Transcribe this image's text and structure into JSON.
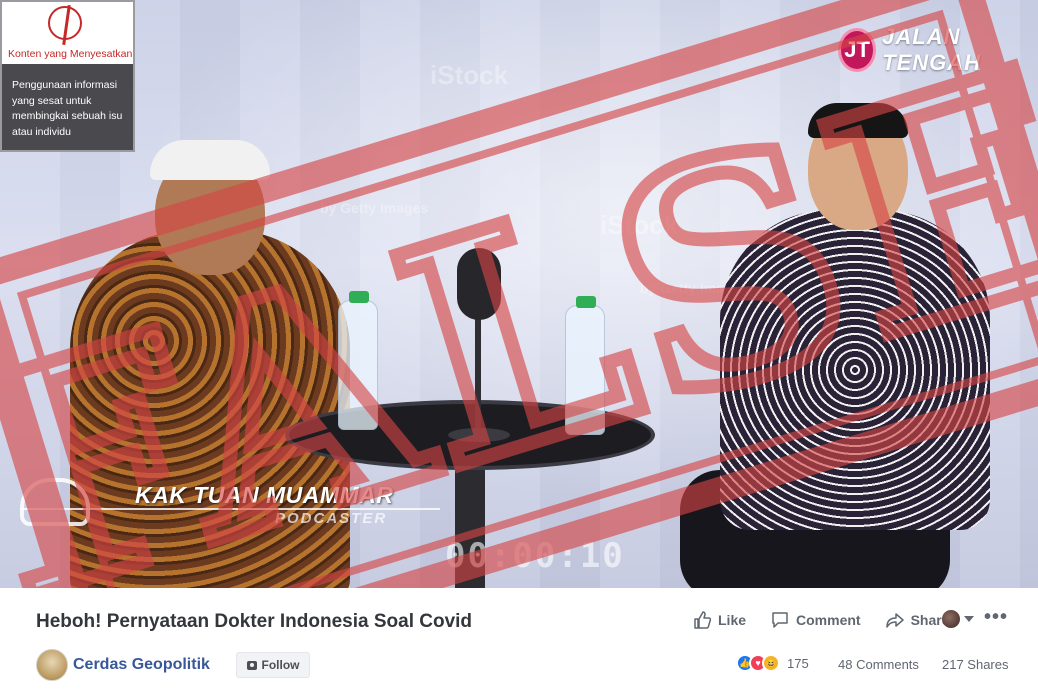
{
  "notice": {
    "label": "Konten yang Menyesatkan",
    "description": "Penggunaan informasi yang sesat untuk membingkai sebuah isu atau individu"
  },
  "video": {
    "channel_logo_text": "JALAN TENGAH",
    "channel_logo_mark": "JT",
    "lower_third_name": "KAK TUAN MUAMMAR",
    "lower_third_sub": "PODCASTER",
    "timecode": "00:00:10",
    "stamp_text": "FALSE",
    "watermarks": [
      "iStock",
      "by Getty Images"
    ]
  },
  "post": {
    "title": "Heboh! Pernyataan Dokter Indonesia Soal Covid",
    "actions": {
      "like": "Like",
      "comment": "Comment",
      "share": "Share"
    },
    "page_name": "Cerdas Geopolitik",
    "follow_label": "Follow",
    "reaction_count": "175",
    "comments": "48 Comments",
    "shares": "217 Shares",
    "icons": [
      "like-icon",
      "comment-icon",
      "share-icon",
      "more-icon"
    ]
  },
  "colors": {
    "link_blue": "#385898",
    "stamp_red": "#d64545",
    "notice_red": "#c62828",
    "text_gray": "#606770"
  }
}
